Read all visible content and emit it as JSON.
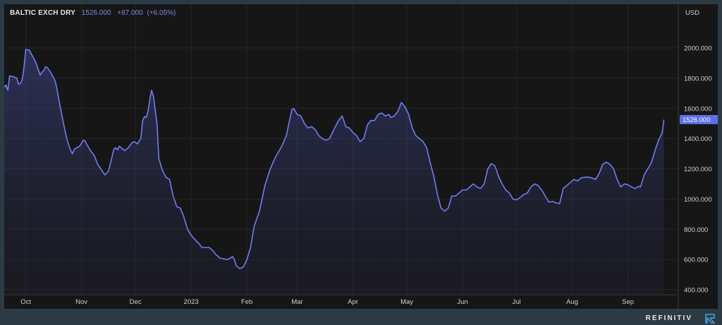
{
  "header": {
    "title": "BALTIC EXCH DRY",
    "value": "1526.000",
    "change": "+87.000",
    "change_pct": "(+6.05%)"
  },
  "brand": {
    "name": "REFINITIV",
    "icon": "refinitiv-logo-icon"
  },
  "colors": {
    "line": "#6f7df0",
    "price_tag_bg": "#5d6fe8",
    "background": "#161616",
    "frame": "#2c3a44"
  },
  "chart_data": {
    "type": "area",
    "title": "BALTIC EXCH DRY",
    "ylabel": "USD",
    "ylim": [
      400,
      2000
    ],
    "yticks": [
      400,
      600,
      800,
      1000,
      1200,
      1400,
      1600,
      1800,
      2000
    ],
    "ytick_labels": [
      "400.000",
      "600.000",
      "800.000",
      "1000.000",
      "1200.000",
      "1400.000",
      "1600.000",
      "1800.000",
      "2000.000"
    ],
    "x_range": [
      "2022-09-19",
      "2023-09-29"
    ],
    "xticks": [
      {
        "label": "Oct",
        "date": "2022-10-01"
      },
      {
        "label": "Nov",
        "date": "2022-11-01"
      },
      {
        "label": "Dec",
        "date": "2022-12-01"
      },
      {
        "label": "2023",
        "date": "2023-01-01"
      },
      {
        "label": "Feb",
        "date": "2023-02-01"
      },
      {
        "label": "Mar",
        "date": "2023-03-01"
      },
      {
        "label": "Apr",
        "date": "2023-04-01"
      },
      {
        "label": "May",
        "date": "2023-05-01"
      },
      {
        "label": "Jun",
        "date": "2023-06-01"
      },
      {
        "label": "Jul",
        "date": "2023-07-01"
      },
      {
        "label": "Aug",
        "date": "2023-08-01"
      },
      {
        "label": "Sep",
        "date": "2023-09-01"
      }
    ],
    "last_value_label": "1526.000",
    "grid": true,
    "series": [
      {
        "points": [
          [
            "2022-09-19",
            1740
          ],
          [
            "2022-09-20",
            1755
          ],
          [
            "2022-09-21",
            1720
          ],
          [
            "2022-09-22",
            1815
          ],
          [
            "2022-09-24",
            1810
          ],
          [
            "2022-09-26",
            1800
          ],
          [
            "2022-09-27",
            1760
          ],
          [
            "2022-09-28",
            1765
          ],
          [
            "2022-09-29",
            1790
          ],
          [
            "2022-09-30",
            1870
          ],
          [
            "2022-10-01",
            1990
          ],
          [
            "2022-10-03",
            1985
          ],
          [
            "2022-10-05",
            1940
          ],
          [
            "2022-10-06",
            1920
          ],
          [
            "2022-10-07",
            1890
          ],
          [
            "2022-10-09",
            1820
          ],
          [
            "2022-10-10",
            1840
          ],
          [
            "2022-10-11",
            1850
          ],
          [
            "2022-10-12",
            1875
          ],
          [
            "2022-10-13",
            1870
          ],
          [
            "2022-10-15",
            1835
          ],
          [
            "2022-10-17",
            1790
          ],
          [
            "2022-10-18",
            1750
          ],
          [
            "2022-10-20",
            1620
          ],
          [
            "2022-10-22",
            1500
          ],
          [
            "2022-10-24",
            1390
          ],
          [
            "2022-10-26",
            1320
          ],
          [
            "2022-10-27",
            1300
          ],
          [
            "2022-10-28",
            1330
          ],
          [
            "2022-10-31",
            1350
          ],
          [
            "2022-11-02",
            1390
          ],
          [
            "2022-11-03",
            1385
          ],
          [
            "2022-11-04",
            1360
          ],
          [
            "2022-11-06",
            1320
          ],
          [
            "2022-11-08",
            1290
          ],
          [
            "2022-11-10",
            1230
          ],
          [
            "2022-11-12",
            1195
          ],
          [
            "2022-11-14",
            1160
          ],
          [
            "2022-11-16",
            1185
          ],
          [
            "2022-11-19",
            1330
          ],
          [
            "2022-11-20",
            1340
          ],
          [
            "2022-11-21",
            1325
          ],
          [
            "2022-11-22",
            1350
          ],
          [
            "2022-11-24",
            1330
          ],
          [
            "2022-11-25",
            1320
          ],
          [
            "2022-11-27",
            1340
          ],
          [
            "2022-11-29",
            1370
          ],
          [
            "2022-11-30",
            1380
          ],
          [
            "2022-12-01",
            1375
          ],
          [
            "2022-12-02",
            1365
          ],
          [
            "2022-12-04",
            1400
          ],
          [
            "2022-12-05",
            1520
          ],
          [
            "2022-12-06",
            1545
          ],
          [
            "2022-12-07",
            1540
          ],
          [
            "2022-12-08",
            1580
          ],
          [
            "2022-12-09",
            1660
          ],
          [
            "2022-12-10",
            1720
          ],
          [
            "2022-12-11",
            1680
          ],
          [
            "2022-12-13",
            1500
          ],
          [
            "2022-12-14",
            1270
          ],
          [
            "2022-12-16",
            1190
          ],
          [
            "2022-12-18",
            1145
          ],
          [
            "2022-12-20",
            1130
          ],
          [
            "2022-12-22",
            1020
          ],
          [
            "2022-12-24",
            950
          ],
          [
            "2022-12-26",
            940
          ],
          [
            "2022-12-28",
            880
          ],
          [
            "2022-12-30",
            800
          ],
          [
            "2023-01-01",
            760
          ],
          [
            "2023-01-04",
            720
          ],
          [
            "2023-01-05",
            710
          ],
          [
            "2023-01-07",
            680
          ],
          [
            "2023-01-09",
            680
          ],
          [
            "2023-01-11",
            680
          ],
          [
            "2023-01-13",
            660
          ],
          [
            "2023-01-15",
            630
          ],
          [
            "2023-01-17",
            610
          ],
          [
            "2023-01-19",
            605
          ],
          [
            "2023-01-21",
            600
          ],
          [
            "2023-01-23",
            610
          ],
          [
            "2023-01-24",
            620
          ],
          [
            "2023-01-25",
            600
          ],
          [
            "2023-01-26",
            560
          ],
          [
            "2023-01-28",
            540
          ],
          [
            "2023-01-30",
            550
          ],
          [
            "2023-02-01",
            600
          ],
          [
            "2023-02-03",
            680
          ],
          [
            "2023-02-05",
            820
          ],
          [
            "2023-02-08",
            920
          ],
          [
            "2023-02-11",
            1090
          ],
          [
            "2023-02-14",
            1200
          ],
          [
            "2023-02-17",
            1280
          ],
          [
            "2023-02-20",
            1340
          ],
          [
            "2023-02-23",
            1420
          ],
          [
            "2023-02-24",
            1480
          ],
          [
            "2023-02-26",
            1590
          ],
          [
            "2023-02-27",
            1600
          ],
          [
            "2023-02-28",
            1580
          ],
          [
            "2023-03-01",
            1560
          ],
          [
            "2023-03-03",
            1550
          ],
          [
            "2023-03-05",
            1500
          ],
          [
            "2023-03-07",
            1470
          ],
          [
            "2023-03-09",
            1480
          ],
          [
            "2023-03-11",
            1460
          ],
          [
            "2023-03-13",
            1420
          ],
          [
            "2023-03-15",
            1400
          ],
          [
            "2023-03-17",
            1390
          ],
          [
            "2023-03-19",
            1400
          ],
          [
            "2023-03-21",
            1450
          ],
          [
            "2023-03-24",
            1520
          ],
          [
            "2023-03-26",
            1550
          ],
          [
            "2023-03-28",
            1480
          ],
          [
            "2023-03-30",
            1470
          ],
          [
            "2023-04-01",
            1440
          ],
          [
            "2023-04-03",
            1420
          ],
          [
            "2023-04-05",
            1380
          ],
          [
            "2023-04-07",
            1400
          ],
          [
            "2023-04-09",
            1490
          ],
          [
            "2023-04-11",
            1520
          ],
          [
            "2023-04-13",
            1520
          ],
          [
            "2023-04-15",
            1560
          ],
          [
            "2023-04-17",
            1570
          ],
          [
            "2023-04-19",
            1550
          ],
          [
            "2023-04-21",
            1560
          ],
          [
            "2023-04-22",
            1540
          ],
          [
            "2023-04-24",
            1550
          ],
          [
            "2023-04-26",
            1580
          ],
          [
            "2023-04-28",
            1640
          ],
          [
            "2023-04-30",
            1610
          ],
          [
            "2023-05-02",
            1560
          ],
          [
            "2023-05-04",
            1470
          ],
          [
            "2023-05-06",
            1420
          ],
          [
            "2023-05-08",
            1400
          ],
          [
            "2023-05-10",
            1380
          ],
          [
            "2023-05-12",
            1340
          ],
          [
            "2023-05-14",
            1240
          ],
          [
            "2023-05-16",
            1150
          ],
          [
            "2023-05-18",
            1030
          ],
          [
            "2023-05-20",
            940
          ],
          [
            "2023-05-22",
            920
          ],
          [
            "2023-05-24",
            940
          ],
          [
            "2023-05-26",
            1020
          ],
          [
            "2023-05-28",
            1020
          ],
          [
            "2023-05-30",
            1040
          ],
          [
            "2023-06-01",
            1060
          ],
          [
            "2023-06-03",
            1060
          ],
          [
            "2023-06-05",
            1080
          ],
          [
            "2023-06-07",
            1100
          ],
          [
            "2023-06-09",
            1080
          ],
          [
            "2023-06-11",
            1070
          ],
          [
            "2023-06-13",
            1100
          ],
          [
            "2023-06-15",
            1200
          ],
          [
            "2023-06-17",
            1235
          ],
          [
            "2023-06-19",
            1220
          ],
          [
            "2023-06-21",
            1150
          ],
          [
            "2023-06-23",
            1100
          ],
          [
            "2023-06-25",
            1060
          ],
          [
            "2023-06-27",
            1040
          ],
          [
            "2023-06-29",
            1000
          ],
          [
            "2023-07-01",
            995
          ],
          [
            "2023-07-03",
            1010
          ],
          [
            "2023-07-05",
            1030
          ],
          [
            "2023-07-07",
            1040
          ],
          [
            "2023-07-09",
            1080
          ],
          [
            "2023-07-11",
            1100
          ],
          [
            "2023-07-13",
            1090
          ],
          [
            "2023-07-15",
            1060
          ],
          [
            "2023-07-17",
            1020
          ],
          [
            "2023-07-19",
            980
          ],
          [
            "2023-07-21",
            985
          ],
          [
            "2023-07-23",
            975
          ],
          [
            "2023-07-25",
            970
          ],
          [
            "2023-07-27",
            1070
          ],
          [
            "2023-07-29",
            1090
          ],
          [
            "2023-07-31",
            1110
          ],
          [
            "2023-08-02",
            1130
          ],
          [
            "2023-08-04",
            1120
          ],
          [
            "2023-08-06",
            1140
          ],
          [
            "2023-08-08",
            1145
          ],
          [
            "2023-08-10",
            1145
          ],
          [
            "2023-08-12",
            1140
          ],
          [
            "2023-08-14",
            1130
          ],
          [
            "2023-08-16",
            1170
          ],
          [
            "2023-08-18",
            1230
          ],
          [
            "2023-08-20",
            1245
          ],
          [
            "2023-08-22",
            1230
          ],
          [
            "2023-08-24",
            1200
          ],
          [
            "2023-08-26",
            1130
          ],
          [
            "2023-08-28",
            1080
          ],
          [
            "2023-08-30",
            1100
          ],
          [
            "2023-09-01",
            1095
          ],
          [
            "2023-09-03",
            1080
          ],
          [
            "2023-09-05",
            1070
          ],
          [
            "2023-09-07",
            1085
          ],
          [
            "2023-09-08",
            1080
          ],
          [
            "2023-09-10",
            1160
          ],
          [
            "2023-09-12",
            1200
          ],
          [
            "2023-09-14",
            1240
          ],
          [
            "2023-09-16",
            1320
          ],
          [
            "2023-09-18",
            1390
          ],
          [
            "2023-09-20",
            1439
          ],
          [
            "2023-09-21",
            1526
          ]
        ]
      }
    ]
  }
}
